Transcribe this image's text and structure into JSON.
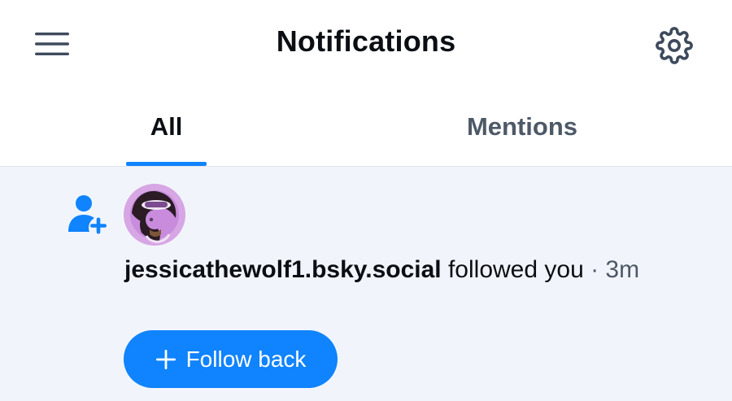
{
  "header": {
    "title": "Notifications",
    "menu_icon": "hamburger-menu-icon",
    "settings_icon": "gear-icon"
  },
  "tabs": [
    {
      "label": "All",
      "selected": true
    },
    {
      "label": "Mentions",
      "selected": false
    }
  ],
  "notifications": [
    {
      "type_icon": "person-add-icon",
      "avatar": "user-avatar",
      "handle": "jessicathewolf1.bsky.social",
      "action": " followed you",
      "separator": " · ",
      "time": "3m",
      "button_label": "Follow back",
      "button_icon": "plus-icon"
    }
  ],
  "colors": {
    "accent": "#1083fe",
    "feed_background": "#f1f5fb",
    "text_primary": "#0b0f14",
    "text_secondary": "#4e5967",
    "icon_gray": "#3e4a5c"
  }
}
